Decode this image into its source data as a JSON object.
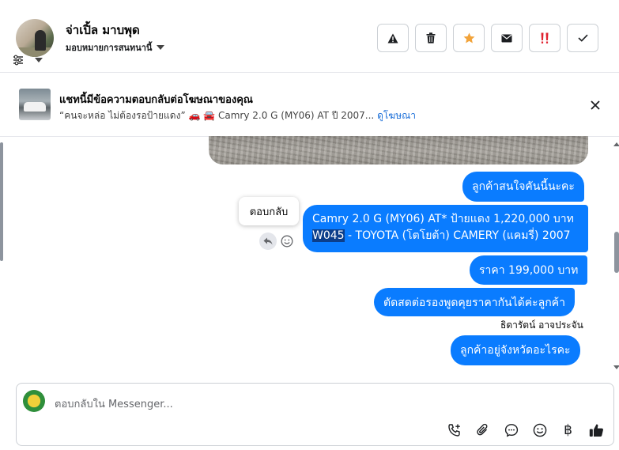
{
  "header": {
    "name": "จ่าเปิ้ล มาบพุด",
    "assign_label": "มอบหมายการสนทนานี้"
  },
  "ad_banner": {
    "title": "แชทนี้มีข้อความตอบกลับต่อโฆษณาของคุณ",
    "subtitle": "“คนจะหล่อ ไม่ต้องรอป้ายแดง” 🚗 🚘 Camry 2.0 G (MY06) AT ปี 2007...",
    "link": "ดูโฆษณา"
  },
  "messages": {
    "m1": "ลูกค้าสนใจคันนี้นะคะ",
    "m2_part1": "Camry 2.0 G (MY06) AT* ป้ายแดง 1,220,000 บาท ",
    "m2_highlight": "W045",
    "m2_part2": " - TOYOTA (โตโยต้า) CAMERY (แคมรี่) 2007",
    "m3": "ราคา 199,000 บาท",
    "m4": "ตัดสดต่อรองพูดคุยราคากันได้ค่ะลูกค้า",
    "sender": "ธิดารัตน์ อาจประจัน",
    "m5": "ลูกค้าอยู่จังหวัดอะไรคะ"
  },
  "tooltip": "ตอบกลับ",
  "composer": {
    "placeholder": "ตอบกลับใน Messenger...",
    "currency_symbol": "฿"
  },
  "colors": {
    "bubble": "#0a7cff",
    "highlight": "#0c3e8a",
    "star": "#f2a33a",
    "urgent": "#e0222f",
    "link": "#1a6ed8"
  },
  "icons": [
    "warning-icon",
    "trash-icon",
    "star-icon",
    "mail-icon",
    "double-exclamation-icon",
    "check-icon",
    "filter-icon",
    "close-icon",
    "reply-icon",
    "emoji-icon",
    "phone-plus-icon",
    "paperclip-icon",
    "chat-bubble-icon",
    "smiley-icon",
    "baht-icon",
    "thumbs-up-icon"
  ]
}
